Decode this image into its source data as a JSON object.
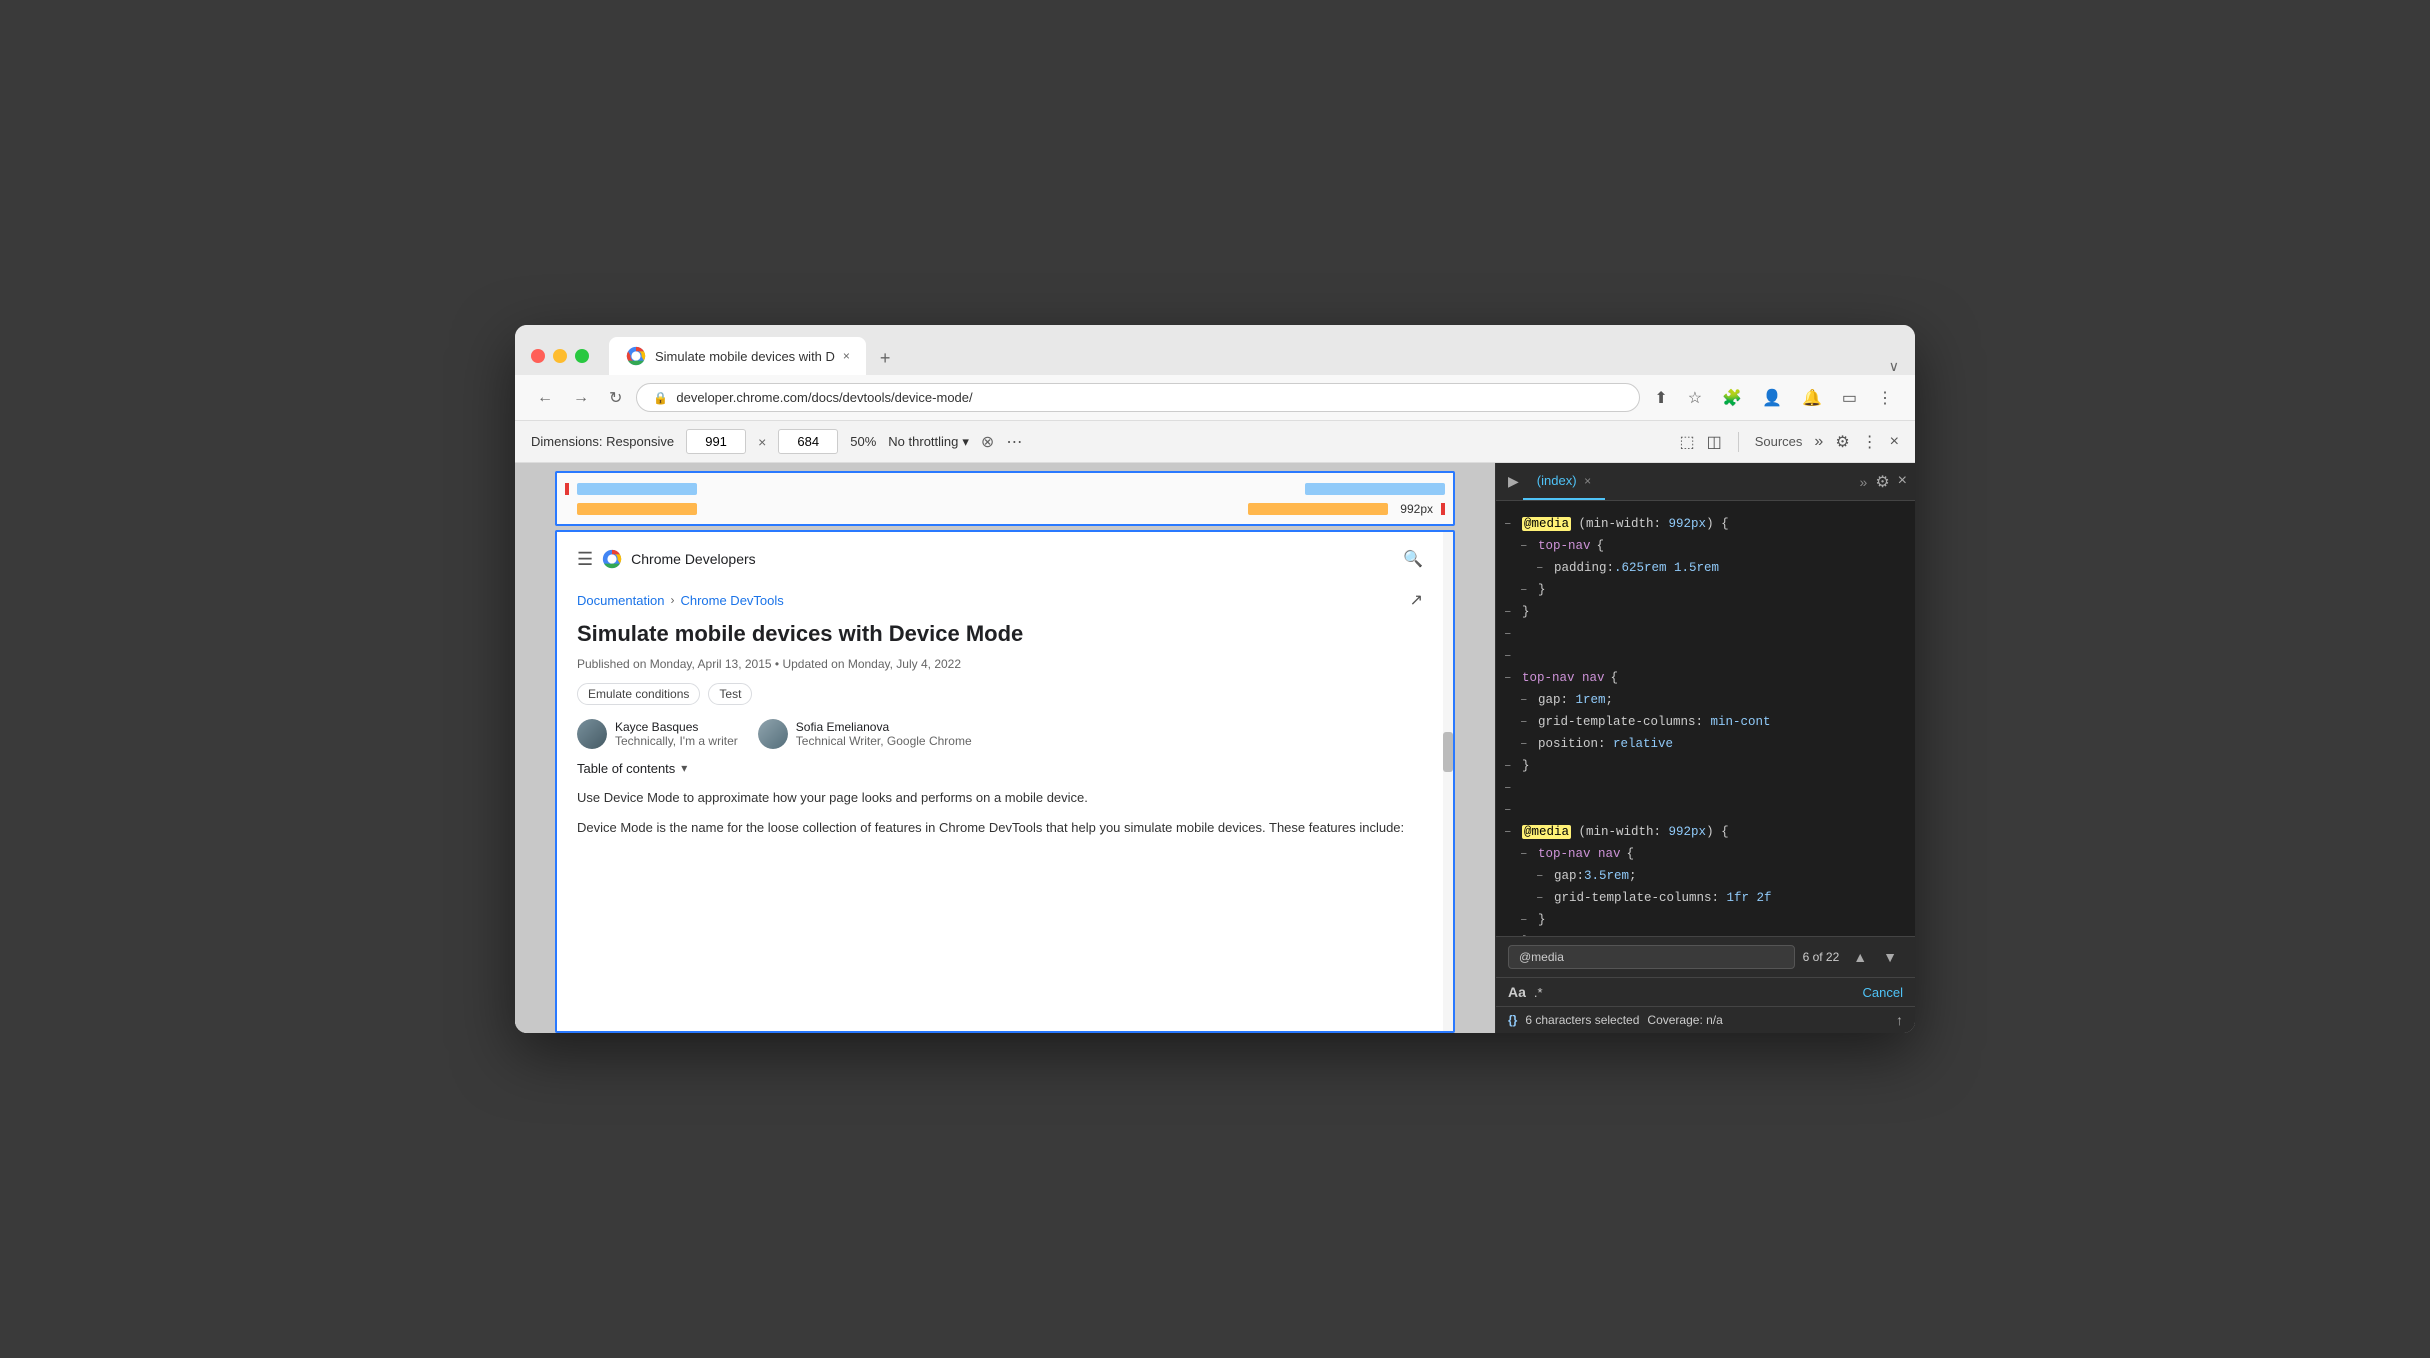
{
  "browser": {
    "tab_title": "Simulate mobile devices with D",
    "url": "developer.chrome.com/docs/devtools/device-mode/",
    "new_tab_label": "+",
    "expand_label": "∨"
  },
  "nav": {
    "back_label": "←",
    "forward_label": "→",
    "reload_label": "↻",
    "lock_icon": "🔒"
  },
  "devtools_toolbar": {
    "dimensions_label": "Dimensions: Responsive",
    "width_value": "991",
    "height_value": "684",
    "zoom_label": "50%",
    "throttle_label": "No throttling",
    "no_sensor_label": "⊗",
    "more_label": "⋯",
    "panel_device_label": "⬚",
    "panel_dock_label": "⬚"
  },
  "devtools_panel": {
    "tab_index_label": "(index)",
    "tab_close_label": "×",
    "tab_more_label": "»",
    "panel_sources_label": "Sources",
    "settings_label": "⚙",
    "menu_label": "⋮",
    "close_label": "×"
  },
  "code": {
    "lines": [
      {
        "minus": "–",
        "content": "@media",
        "type": "media-keyword",
        "rest": " (min-width: 992px) {"
      },
      {
        "minus": "–",
        "content": "  top-nav {",
        "type": "selector"
      },
      {
        "minus": "–",
        "content": "    padding:.625rem 1.5rem",
        "type": "property"
      },
      {
        "minus": "–",
        "content": "  }",
        "type": "brace"
      },
      {
        "minus": "–",
        "content": "}",
        "type": "brace"
      },
      {
        "minus": "–",
        "content": "",
        "type": "empty"
      },
      {
        "minus": "–",
        "content": "",
        "type": "empty"
      },
      {
        "minus": "–",
        "content": "top-nav nav {",
        "type": "selector"
      },
      {
        "minus": "–",
        "content": "  gap: 1rem;",
        "type": "property"
      },
      {
        "minus": "–",
        "content": "  grid-template-columns: min-cont",
        "type": "property-truncated"
      },
      {
        "minus": "–",
        "content": "  position: relative",
        "type": "property"
      },
      {
        "minus": "–",
        "content": "}",
        "type": "brace"
      },
      {
        "minus": "–",
        "content": "",
        "type": "empty"
      },
      {
        "minus": "–",
        "content": "",
        "type": "empty"
      },
      {
        "minus": "–",
        "content": "@media",
        "type": "media-keyword2",
        "rest": " (min-width: 992px) {"
      },
      {
        "minus": "–",
        "content": "  top-nav nav {",
        "type": "selector"
      },
      {
        "minus": "–",
        "content": "    gap:3.5rem;",
        "type": "property"
      },
      {
        "minus": "–",
        "content": "    grid-template-columns: 1fr 2f",
        "type": "property-truncated"
      },
      {
        "minus": "–",
        "content": "  }",
        "type": "brace"
      },
      {
        "minus": "–",
        "content": "}",
        "type": "brace"
      }
    ]
  },
  "search_bar": {
    "label": "@media",
    "count": "6 of 22",
    "up_label": "▲",
    "down_label": "▼"
  },
  "filter_bar": {
    "aa_label": "Aa",
    "regex_label": ".*",
    "cancel_label": "Cancel"
  },
  "status_bar": {
    "braces_label": "{}",
    "text": "6 characters selected",
    "coverage": "Coverage: n/a",
    "scroll_label": "↑"
  },
  "article": {
    "breadcrumb_doc": "Documentation",
    "breadcrumb_sep": "›",
    "breadcrumb_devtools": "Chrome DevTools",
    "title": "Simulate mobile devices with Device Mode",
    "meta": "Published on Monday, April 13, 2015 • Updated on Monday, July 4, 2022",
    "tag1": "Emulate conditions",
    "tag2": "Test",
    "author1_name": "Kayce Basques",
    "author1_title": "Technically, I'm a writer",
    "author2_name": "Sofia Emelianova",
    "author2_title": "Technical Writer, Google Chrome",
    "toc_label": "Table of contents",
    "toc_arrow": "▾",
    "para1": "Use Device Mode to approximate how your page looks and performs on a mobile device.",
    "para2": "Device Mode is the name for the loose collection of features in Chrome DevTools that help you simulate mobile devices. These features include:"
  },
  "ruler": {
    "label_992": "992px"
  }
}
